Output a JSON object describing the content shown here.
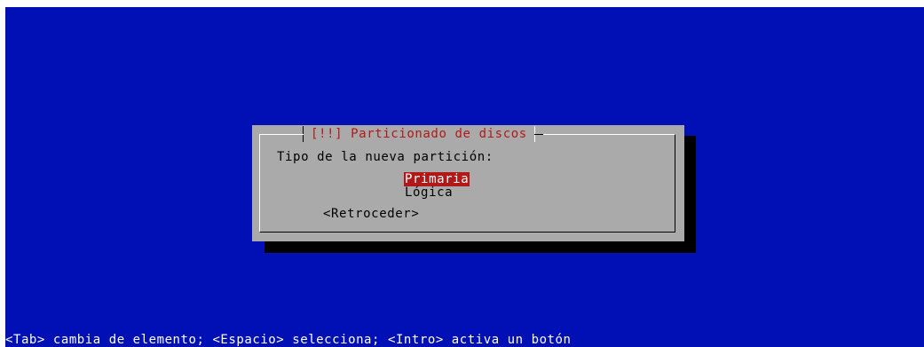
{
  "dialog": {
    "title": "[!!] Particionado de discos",
    "prompt": "Tipo de la nueva partición:",
    "options": [
      {
        "label": "Primaria",
        "selected": true
      },
      {
        "label": "Lógica",
        "selected": false
      }
    ],
    "back_button_label": "<Retroceder>"
  },
  "status_bar": {
    "text": "<Tab> cambia de elemento; <Espacio> selecciona; <Intro> activa un botón"
  },
  "colors": {
    "screen_background": "#0010b5",
    "dialog_background": "#aaaaaa",
    "title_text": "#b21818",
    "selection_background": "#b21818",
    "selection_text": "#ffffff",
    "status_text": "#ffffff",
    "shadow": "#000000"
  }
}
